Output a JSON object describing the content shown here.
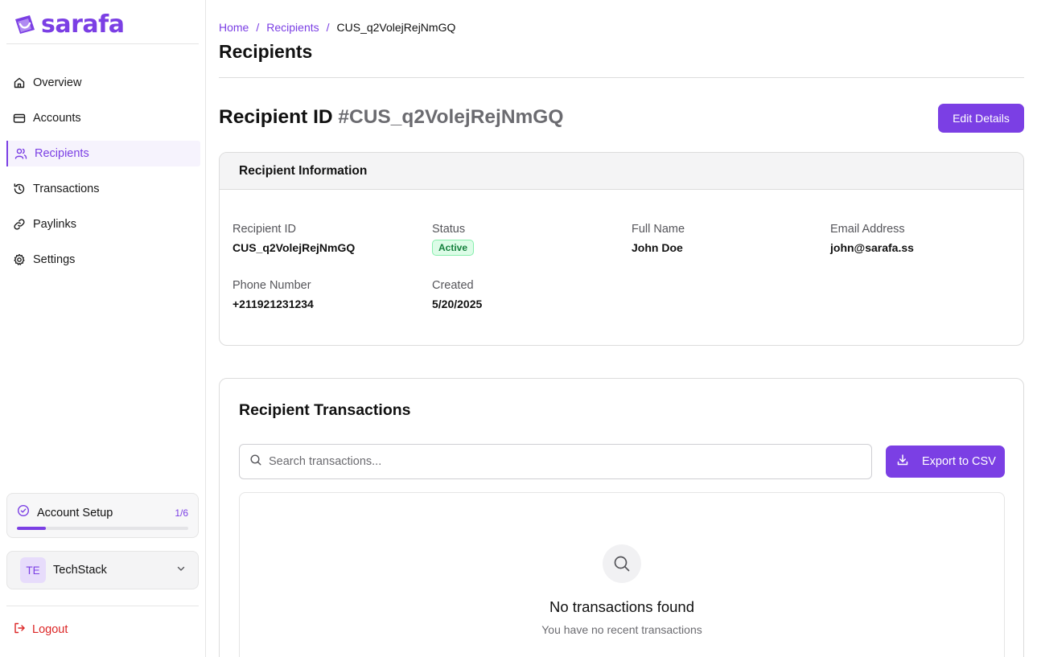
{
  "brand": {
    "name": "sarafa",
    "accent": "#7b3fe4"
  },
  "sidebar": {
    "items": [
      {
        "label": "Overview",
        "icon": "home-icon"
      },
      {
        "label": "Accounts",
        "icon": "credit-card-icon"
      },
      {
        "label": "Recipients",
        "icon": "users-icon",
        "active": true
      },
      {
        "label": "Transactions",
        "icon": "history-icon"
      },
      {
        "label": "Paylinks",
        "icon": "link-icon"
      },
      {
        "label": "Settings",
        "icon": "gear-icon"
      }
    ],
    "setup": {
      "title": "Account Setup",
      "count": "1/6",
      "progress_fraction": 0.167
    },
    "org": {
      "initials": "TE",
      "name": "TechStack"
    },
    "logout_label": "Logout"
  },
  "breadcrumb": {
    "home": "Home",
    "section": "Recipients",
    "current": "CUS_q2VolejRejNmGQ",
    "separator": "/"
  },
  "page_title": "Recipients",
  "recipient_header": {
    "prefix": "Recipient ID",
    "id": "#CUS_q2VolejRejNmGQ",
    "edit_label": "Edit Details"
  },
  "info_card": {
    "title": "Recipient Information",
    "fields": {
      "recipient_id": {
        "label": "Recipient ID",
        "value": "CUS_q2VolejRejNmGQ"
      },
      "status": {
        "label": "Status",
        "value": "Active"
      },
      "full_name": {
        "label": "Full Name",
        "value": "John Doe"
      },
      "email": {
        "label": "Email Address",
        "value": "john@sarafa.ss"
      },
      "phone": {
        "label": "Phone Number",
        "value": "+211921231234"
      },
      "created": {
        "label": "Created",
        "value": "5/20/2025"
      }
    }
  },
  "transactions": {
    "title": "Recipient Transactions",
    "search_placeholder": "Search transactions...",
    "export_label": "Export to CSV",
    "empty_title": "No transactions found",
    "empty_subtitle": "You have no recent transactions"
  }
}
